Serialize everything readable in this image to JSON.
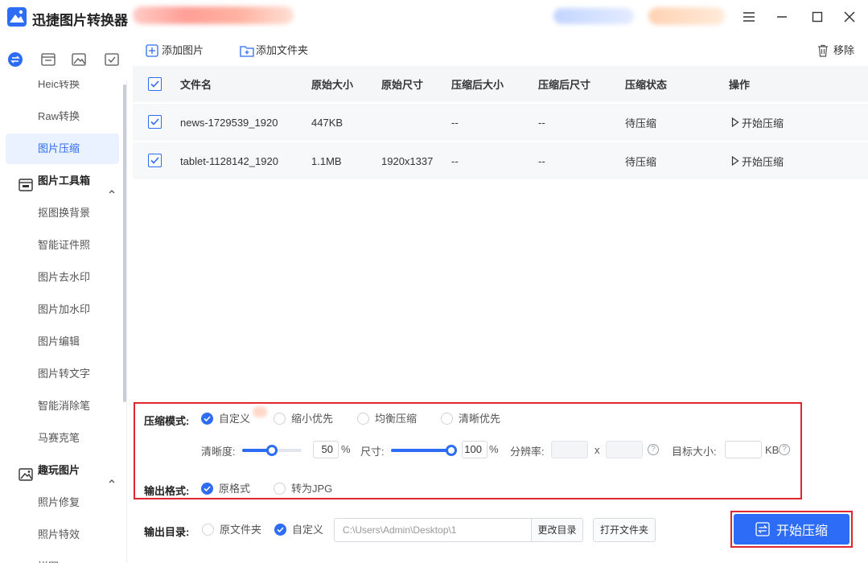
{
  "app": {
    "title": "迅捷图片转换器"
  },
  "toolbar": {
    "add_image": "添加图片",
    "add_folder": "添加文件夹",
    "remove": "移除"
  },
  "sidebar": {
    "items": [
      {
        "label": "Heic转换",
        "active": false
      },
      {
        "label": "Raw转换",
        "active": false
      },
      {
        "label": "图片压缩",
        "active": true
      }
    ],
    "groups": [
      {
        "label": "图片工具箱",
        "items": [
          "抠图换背景",
          "智能证件照",
          "图片去水印",
          "图片加水印",
          "图片编辑",
          "图片转文字",
          "智能消除笔",
          "马赛克笔"
        ]
      },
      {
        "label": "趣玩图片",
        "items": [
          "照片修复",
          "照片特效",
          "拼图"
        ]
      }
    ]
  },
  "table": {
    "columns": [
      "文件名",
      "原始大小",
      "原始尺寸",
      "压缩后大小",
      "压缩后尺寸",
      "压缩状态",
      "操作"
    ],
    "rows": [
      {
        "name": "news-1729539_1920",
        "size": "447KB",
        "dims": "",
        "csize": "--",
        "cdims": "--",
        "status": "待压缩",
        "action": "开始压缩"
      },
      {
        "name": "tablet-1128142_1920",
        "size": "1.1MB",
        "dims": "1920x1337",
        "csize": "--",
        "cdims": "--",
        "status": "待压缩",
        "action": "开始压缩"
      }
    ]
  },
  "settings": {
    "mode_label": "压缩模式:",
    "modes": [
      "自定义",
      "缩小优先",
      "均衡压缩",
      "清晰优先"
    ],
    "selected_mode": "自定义",
    "clarity_label": "清晰度:",
    "clarity_value": "50",
    "size_label": "尺寸:",
    "size_value": "100",
    "percent": "%",
    "resolution_label": "分辨率:",
    "times": "x",
    "target_label": "目标大小:",
    "kb": "KB",
    "format_label": "输出格式:",
    "formats": [
      "原格式",
      "转为JPG"
    ],
    "selected_format": "原格式"
  },
  "output": {
    "label": "输出目录:",
    "options": [
      "原文件夹",
      "自定义"
    ],
    "selected": "自定义",
    "path": "C:\\Users\\Admin\\Desktop\\1",
    "change_dir": "更改目录",
    "open_folder": "打开文件夹"
  },
  "start_button": "开始压缩",
  "colors": {
    "accent": "#2d6cf6",
    "highlight_border": "#e0262e"
  }
}
